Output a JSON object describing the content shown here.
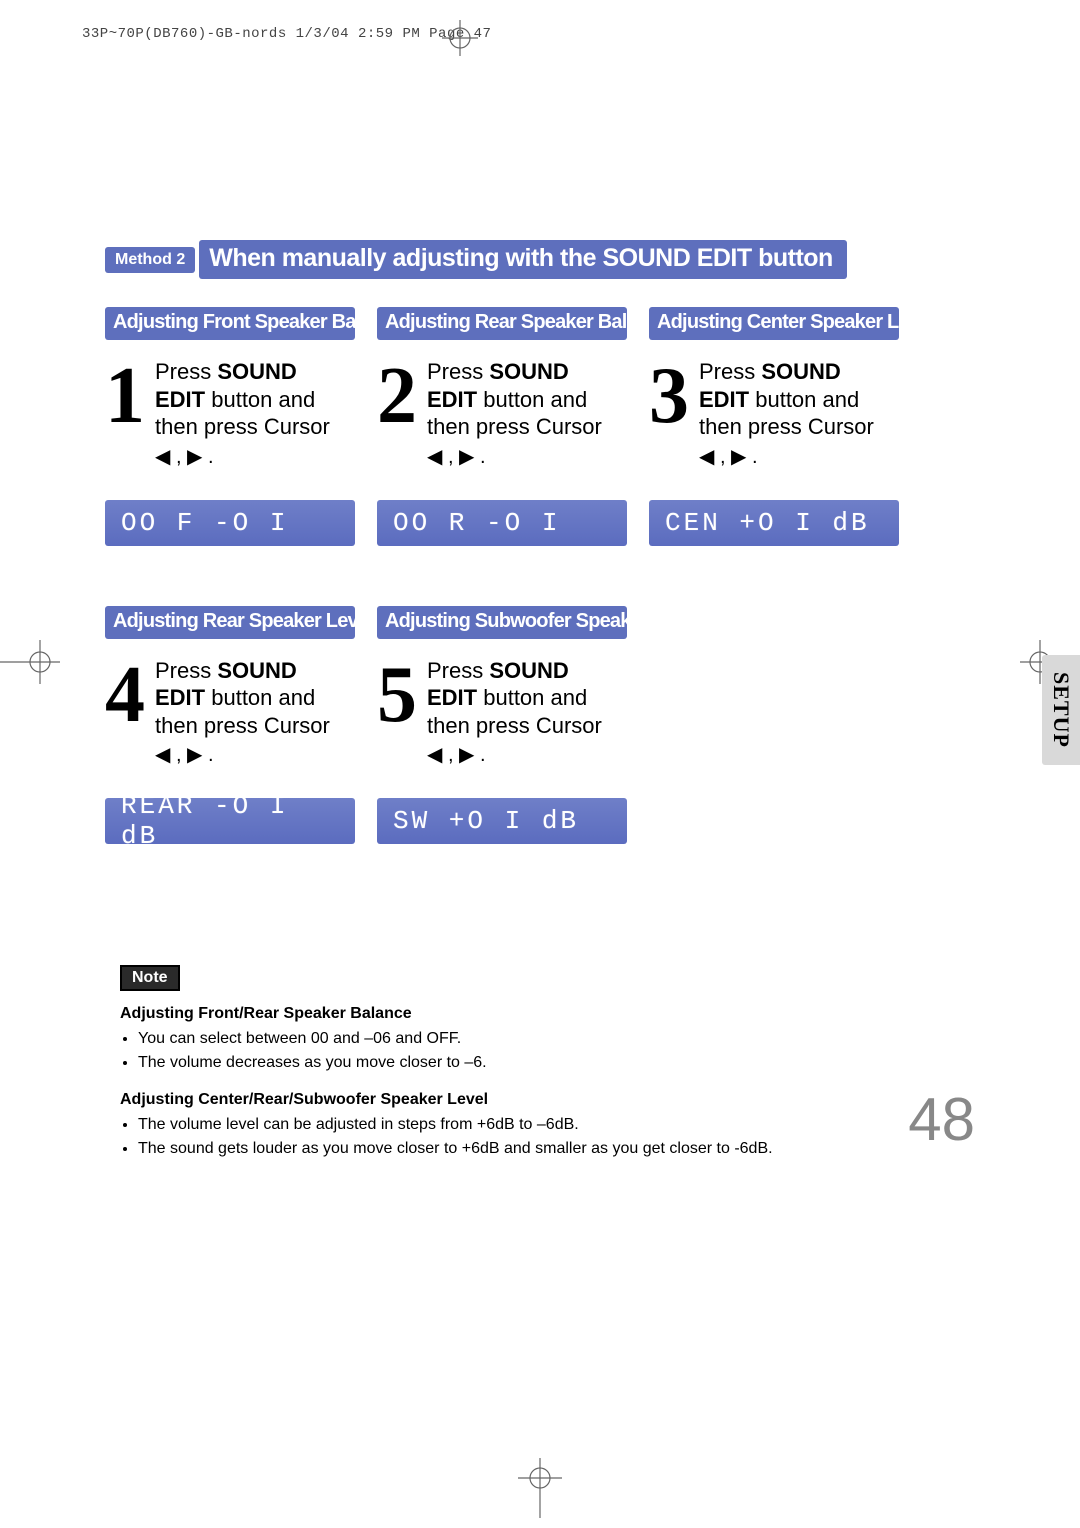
{
  "print_header": "33P~70P(DB760)-GB-nords  1/3/04 2:59 PM  Page 47",
  "method": {
    "badge": "Method 2",
    "heading": "When manually adjusting with the SOUND EDIT button"
  },
  "common": {
    "press": "Press ",
    "sound_edit_a": "SOUND",
    "sound_edit_b": "EDIT",
    "desc_tail": " button and then press Cursor",
    "arrows": "◀ , ▶ ."
  },
  "steps": [
    {
      "num": "1",
      "title": "Adjusting Front Speaker Balance",
      "lcd": "OO F -O I"
    },
    {
      "num": "2",
      "title": "Adjusting Rear Speaker Balance",
      "lcd": "OO R -O I"
    },
    {
      "num": "3",
      "title": "Adjusting Center Speaker Level",
      "lcd": "CEN  +O I dB"
    },
    {
      "num": "4",
      "title": "Adjusting Rear Speaker Level",
      "lcd": "REAR -O I dB"
    },
    {
      "num": "5",
      "title": "Adjusting Subwoofer Speaker Level",
      "lcd": "SW   +O I dB"
    }
  ],
  "setup_tab": "SETUP",
  "note": {
    "badge": "Note",
    "sec1_title": "Adjusting Front/Rear Speaker Balance",
    "sec1_items": [
      "You can select between 00 and –06 and OFF.",
      "The volume decreases as you move closer to –6."
    ],
    "sec2_title": "Adjusting Center/Rear/Subwoofer Speaker Level",
    "sec2_items": [
      "The volume level can be adjusted in steps from +6dB to –6dB.",
      "The sound gets louder as you move closer to +6dB and smaller as you get closer to -6dB."
    ]
  },
  "page_number": "48"
}
